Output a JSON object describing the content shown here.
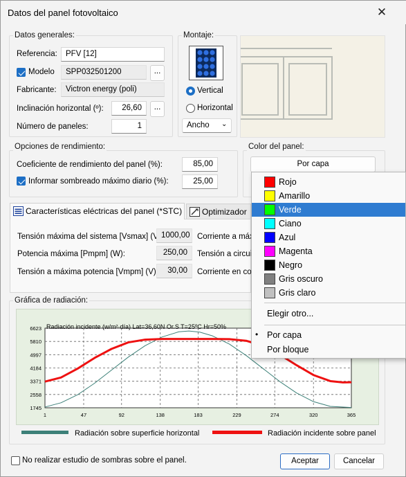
{
  "window": {
    "title": "Datos del panel fotovoltaico"
  },
  "general": {
    "legend": "Datos generales:",
    "referencia_label": "Referencia:",
    "referencia_value": "PFV [12]",
    "modelo_label": "Modelo",
    "modelo_checked": true,
    "modelo_value": "SPP032501200",
    "fabricante_label": "Fabricante:",
    "fabricante_value": "Victron energy (poli)",
    "inclinacion_label": "Inclinación horizontal (º):",
    "inclinacion_value": "26,60",
    "numero_label": "Número de paneles:",
    "numero_value": "1",
    "ellipsis": "..."
  },
  "montaje": {
    "legend": "Montaje:",
    "vertical_label": "Vertical",
    "horizontal_label": "Horizontal",
    "selected": "Vertical",
    "dropdown_value": "Ancho"
  },
  "rendimiento": {
    "legend": "Opciones de rendimiento:",
    "coef_label": "Coeficiente de rendimiento del panel (%):",
    "coef_value": "85,00",
    "informar_label": "Informar sombreado máximo diario (%):",
    "informar_checked": true,
    "informar_value": "25,00"
  },
  "color": {
    "legend": "Color del panel:",
    "button_label": "Por capa"
  },
  "color_menu": {
    "items": [
      {
        "label": "Rojo",
        "color": "#ff0000"
      },
      {
        "label": "Amarillo",
        "color": "#ffff00"
      },
      {
        "label": "Verde",
        "color": "#00ff00"
      },
      {
        "label": "Ciano",
        "color": "#00ffff"
      },
      {
        "label": "Azul",
        "color": "#0000ff"
      },
      {
        "label": "Magenta",
        "color": "#ff00ff"
      },
      {
        "label": "Negro",
        "color": "#000000"
      },
      {
        "label": "Gris oscuro",
        "color": "#808080"
      },
      {
        "label": "Gris claro",
        "color": "#c0c0c0"
      }
    ],
    "highlighted": "Verde",
    "elegir": "Elegir otro...",
    "por_capa": "Por capa",
    "por_bloque": "Por bloque",
    "checked_option": "Por capa"
  },
  "tabs": {
    "tab1": "Características eléctricas del panel (*STC)",
    "tab2": "Optimizador"
  },
  "electricas": {
    "tension_max_label": "Tensión máxima del sistema [Vsmax] (V):",
    "tension_max_value": "1000,00",
    "potencia_label": "Potencia máxima [Pmpm] (W):",
    "potencia_value": "250,00",
    "tension_pot_label": "Tensión a máxima potencia [Vmpm] (V):",
    "tension_pot_value": "30,00",
    "corriente_max_label": "Corriente a máx",
    "tension_circ_label": "Tensión a circuit",
    "corriente_cc_label": "Corriente en cor"
  },
  "grafica": {
    "legend": "Gráfica de radiación:",
    "legend_horizontal": "Radiación sobre superficie horizontal",
    "legend_incidente": "Radiación incidente sobre panel"
  },
  "chart_data": {
    "type": "line",
    "title": "Radiación incidente (w/m²·día) Lat=36,60N Or.S T=25ºC Hr=50%",
    "x_ticks": [
      1,
      47,
      92,
      138,
      183,
      229,
      274,
      320,
      365
    ],
    "y_ticks": [
      1745,
      2558,
      3371,
      4184,
      4997,
      5810,
      6623
    ],
    "xlim": [
      1,
      365
    ],
    "ylim": [
      1745,
      6623
    ],
    "grid": true,
    "series": [
      {
        "name": "Radiación sobre superficie horizontal",
        "color": "#3c8078",
        "x": [
          1,
          20,
          40,
          60,
          80,
          100,
          120,
          140,
          160,
          172,
          185,
          200,
          220,
          240,
          260,
          280,
          300,
          320,
          340,
          365
        ],
        "y": [
          1790,
          2050,
          2550,
          3250,
          4050,
          4850,
          5550,
          6080,
          6400,
          6450,
          6380,
          6150,
          5650,
          4950,
          4150,
          3350,
          2650,
          2120,
          1830,
          1760
        ]
      },
      {
        "name": "Radiación incidente sobre panel",
        "color": "#ee1111",
        "x": [
          1,
          20,
          40,
          60,
          80,
          100,
          120,
          140,
          160,
          180,
          200,
          220,
          240,
          260,
          280,
          300,
          320,
          340,
          355,
          365
        ],
        "y": [
          3350,
          3600,
          4150,
          4800,
          5350,
          5750,
          5920,
          5960,
          5960,
          5960,
          5960,
          5950,
          5850,
          5550,
          5000,
          4350,
          3750,
          3380,
          3300,
          3310
        ]
      }
    ]
  },
  "footer": {
    "sombras_label": "No realizar estudio de sombras sobre el panel.",
    "sombras_checked": false,
    "aceptar": "Aceptar",
    "cancelar": "Cancelar"
  }
}
